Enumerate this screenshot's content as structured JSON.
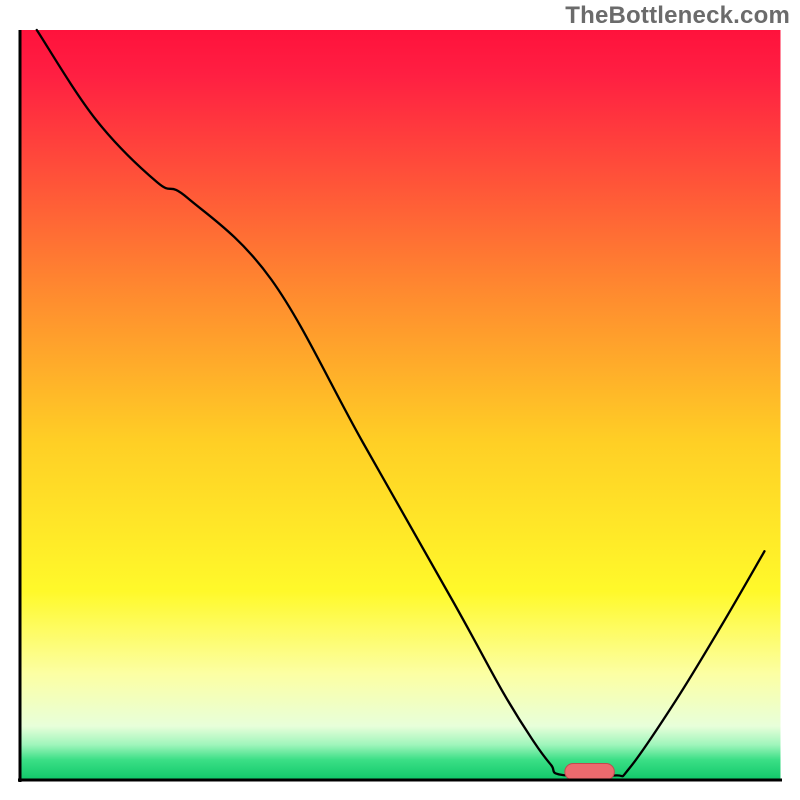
{
  "watermark": "TheBottleneck.com",
  "chart_data": {
    "type": "line",
    "title": "",
    "xlabel": "",
    "ylabel": "",
    "xlim": [
      0,
      100
    ],
    "ylim": [
      0,
      100
    ],
    "background_gradient": {
      "stops": [
        {
          "offset": 0.0,
          "color": "#ff123c"
        },
        {
          "offset": 0.06,
          "color": "#ff1f42"
        },
        {
          "offset": 0.35,
          "color": "#ff8a2f"
        },
        {
          "offset": 0.55,
          "color": "#ffcf25"
        },
        {
          "offset": 0.75,
          "color": "#fff92a"
        },
        {
          "offset": 0.86,
          "color": "#fcffa3"
        },
        {
          "offset": 0.93,
          "color": "#e8ffda"
        },
        {
          "offset": 0.955,
          "color": "#9ff5bb"
        },
        {
          "offset": 0.975,
          "color": "#3bdf86"
        },
        {
          "offset": 1.0,
          "color": "#13c96b"
        }
      ]
    },
    "series": [
      {
        "name": "bottleneck-curve",
        "color": "#000000",
        "width": 2.3,
        "points": [
          {
            "x": 2.2,
            "y": 100.0
          },
          {
            "x": 10.0,
            "y": 88.0
          },
          {
            "x": 18.0,
            "y": 79.7
          },
          {
            "x": 22.0,
            "y": 77.6
          },
          {
            "x": 33.0,
            "y": 66.7
          },
          {
            "x": 45.0,
            "y": 45.0
          },
          {
            "x": 57.0,
            "y": 23.5
          },
          {
            "x": 63.5,
            "y": 11.5
          },
          {
            "x": 67.5,
            "y": 5.0
          },
          {
            "x": 69.7,
            "y": 2.0
          },
          {
            "x": 71.0,
            "y": 0.7
          },
          {
            "x": 78.0,
            "y": 0.6
          },
          {
            "x": 80.0,
            "y": 1.6
          },
          {
            "x": 86.0,
            "y": 10.5
          },
          {
            "x": 92.0,
            "y": 20.5
          },
          {
            "x": 97.7,
            "y": 30.5
          }
        ]
      }
    ],
    "marker": {
      "name": "optimal-range",
      "x0": 71.5,
      "x1": 78.0,
      "y": 1.1,
      "height": 2.2,
      "fill": "#ec6a6e",
      "stroke": "#c1494e"
    },
    "axes": {
      "stroke": "#000000",
      "width": 3
    }
  }
}
